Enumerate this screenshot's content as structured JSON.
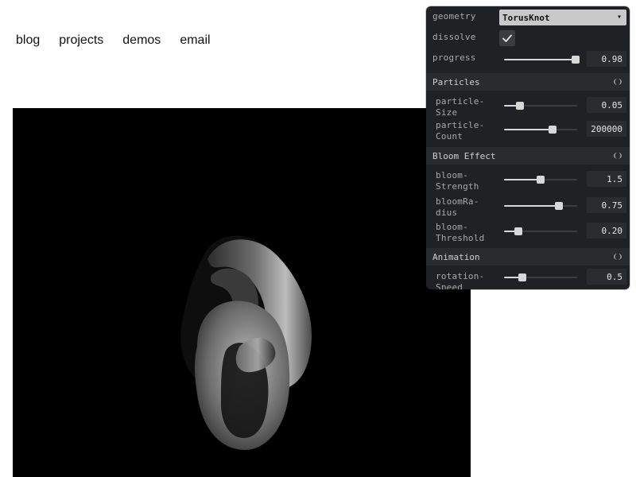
{
  "nav": {
    "items": [
      "blog",
      "projects",
      "demos",
      "email"
    ]
  },
  "gui": {
    "geometry_label": "geometry",
    "geometry_value": "TorusKnot",
    "dissolve_label": "dissolve",
    "dissolve_checked": true,
    "progress_label": "progress",
    "progress_value": "0.98",
    "progress_fraction": 0.98,
    "particles_title": "Particles",
    "particle_size_label_line1": "particle-",
    "particle_size_label_line2": "Size",
    "particle_size_value": "0.05",
    "particle_size_fraction": 0.22,
    "particle_count_label_line1": "particle-",
    "particle_count_label_line2": "Count",
    "particle_count_value": "200000",
    "particle_count_fraction": 0.66,
    "bloom_title": "Bloom Effect",
    "bloom_strength_label_line1": "bloom-",
    "bloom_strength_label_line2": "Strength",
    "bloom_strength_value": "1.5",
    "bloom_strength_fraction": 0.5,
    "bloom_radius_label_line1": "bloomRa-",
    "bloom_radius_label_line2": "dius",
    "bloom_radius_value": "0.75",
    "bloom_radius_fraction": 0.75,
    "bloom_threshold_label_line1": "bloom-",
    "bloom_threshold_label_line2": "Threshold",
    "bloom_threshold_value": "0.20",
    "bloom_threshold_fraction": 0.2,
    "animation_title": "Animation",
    "rotation_speed_label_line1": "rotation-",
    "rotation_speed_label_line2": "Speed",
    "rotation_speed_value": "0.5",
    "rotation_speed_fraction": 0.25
  },
  "icons": {
    "checkmark": "checkmark-icon",
    "chevron": "chevron-down-icon",
    "collapse": "collapse-icon"
  }
}
